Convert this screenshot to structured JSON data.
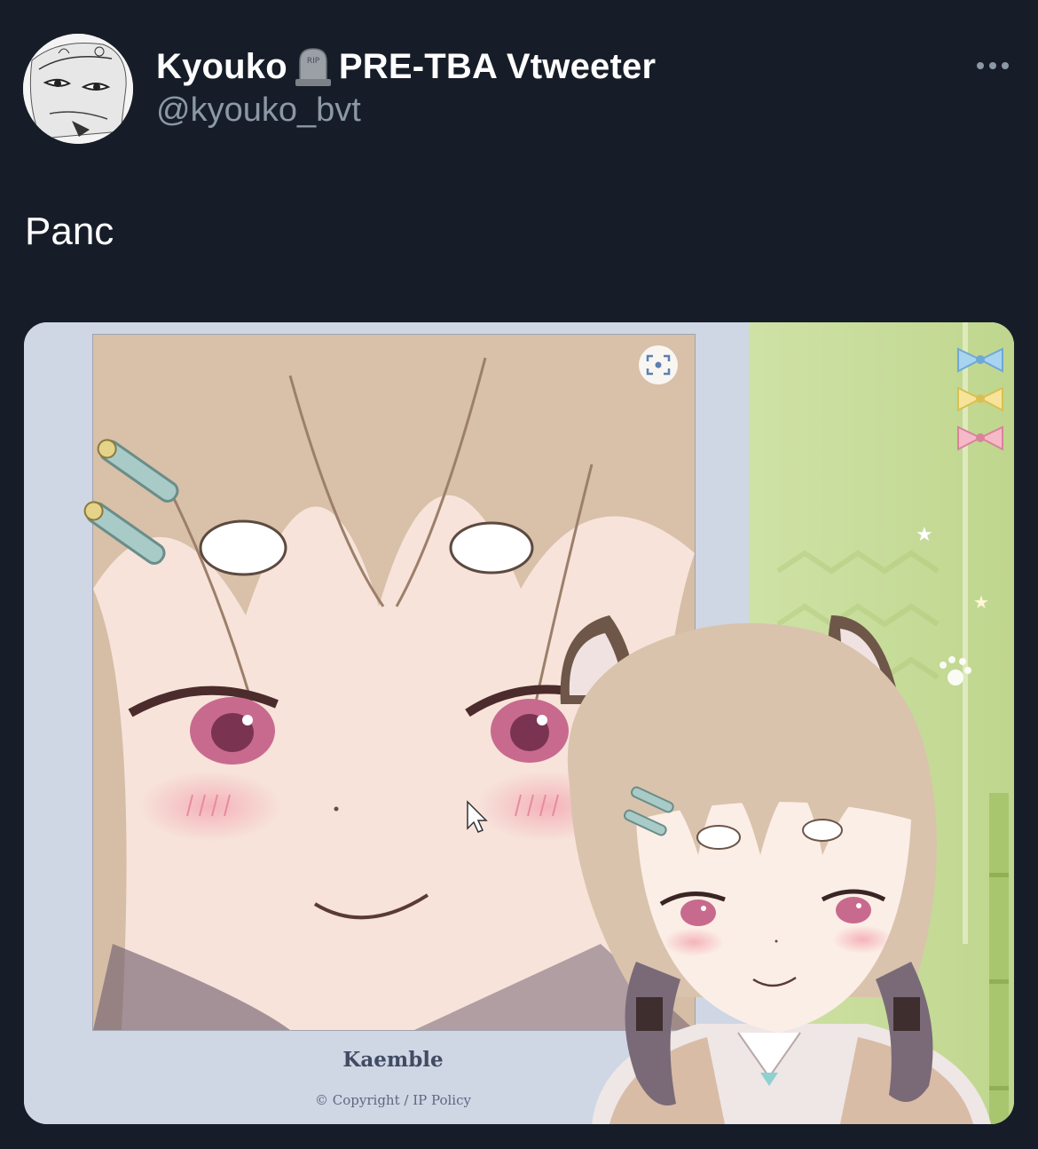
{
  "tweet": {
    "author": {
      "display_name": "Kyouko",
      "display_name_suffix": "PRE-TBA Vtweeter",
      "name_emoji": "headstone-icon",
      "handle": "@kyouko_bvt"
    },
    "text": "Panc",
    "more_icon": "ellipsis-icon"
  },
  "media": {
    "caption_title": "Kaemble",
    "caption_footer": "© Copyright / IP Policy",
    "scan_icon": "scan-icon",
    "bows": [
      "blue-bow-icon",
      "yellow-bow-icon",
      "pink-bow-icon"
    ],
    "colors": {
      "panel_bg": "#cfd6e4",
      "green_bg": "#c9dd9c",
      "hair": "#d9c3ad",
      "skin": "#fbeee6",
      "eye": "#c86a8e"
    }
  },
  "colors": {
    "background": "#171d28",
    "text_primary": "#ffffff",
    "text_secondary": "#8b98a5"
  }
}
